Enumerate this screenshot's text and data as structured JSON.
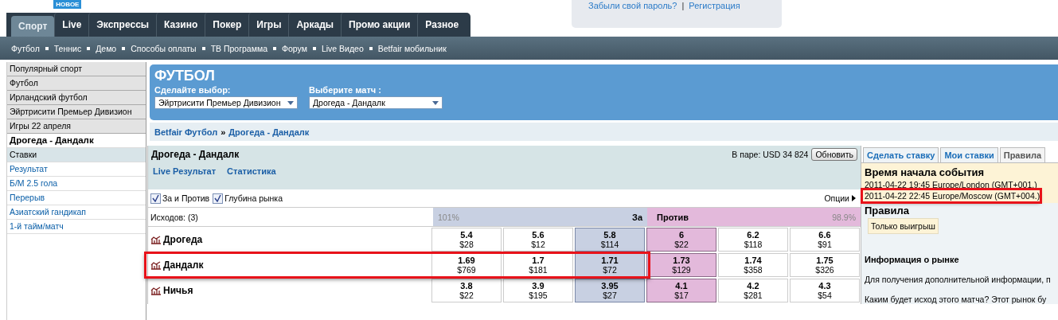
{
  "nav": {
    "badge": "НОВОЕ",
    "tabs": [
      {
        "label": "Спорт",
        "selected": true
      },
      {
        "label": "Live",
        "selected": false
      },
      {
        "label": "Экспрессы",
        "selected": false
      },
      {
        "label": "Казино",
        "selected": false
      },
      {
        "label": "Покер",
        "selected": false
      },
      {
        "label": "Игры",
        "selected": false
      },
      {
        "label": "Аркады",
        "selected": false
      },
      {
        "label": "Промо акции",
        "selected": false
      },
      {
        "label": "Разное",
        "selected": false
      }
    ]
  },
  "subnav": [
    "Футбол",
    "Теннис",
    "Демо",
    "Способы оплаты",
    "ТВ Программа",
    "Форум",
    "Live Видео",
    "Betfair мобильник"
  ],
  "login": {
    "links": [
      "Забыли свой пароль?",
      "Регистрация"
    ],
    "separator": "|"
  },
  "sidebar": [
    {
      "label": "Популярный спорт",
      "kind": "group"
    },
    {
      "label": "Футбол",
      "kind": "group"
    },
    {
      "label": "Ирландский футбол",
      "kind": "group"
    },
    {
      "label": "Эйртрисити Премьер Дивизион",
      "kind": "group"
    },
    {
      "label": "Игры 22 апреля",
      "kind": "group"
    },
    {
      "label": "Дрогеда - Дандалк",
      "kind": "current"
    },
    {
      "label": "Ставки",
      "kind": "section"
    },
    {
      "label": "Результат",
      "kind": "link"
    },
    {
      "label": "Б/М 2.5 гола",
      "kind": "link"
    },
    {
      "label": "Перерыв",
      "kind": "link"
    },
    {
      "label": "Азиатский гандикап",
      "kind": "link"
    },
    {
      "label": "1-й тайм/матч",
      "kind": "link"
    }
  ],
  "header": {
    "title": "ФУТБОЛ",
    "selects": [
      {
        "label": "Сделайте выбор:",
        "value": "Эйртрисити Премьер Дивизион"
      },
      {
        "label": "Выберите матч :",
        "value": "Дрогеда - Дандалк"
      }
    ]
  },
  "breadcrumb": {
    "items": [
      "Betfair Футбол",
      "Дрогеда - Дандалк"
    ],
    "separator": "»"
  },
  "market": {
    "title": "Дрогеда - Дандалк",
    "matched": "В паре: USD 34 824",
    "refresh": "Обновить",
    "links": [
      "Live Результат",
      "Статистика"
    ],
    "options": [
      {
        "label": "За и Против",
        "checked": true
      },
      {
        "label": "Глубина рынка",
        "checked": true
      }
    ],
    "options_menu": "Опции",
    "runners_count": "Исходов:  (3)",
    "back_header": {
      "percent": "101%",
      "label": "За"
    },
    "lay_header": {
      "label": "Против",
      "percent": "98.9%"
    },
    "runners": [
      {
        "name": "Дрогеда",
        "highlighted": false,
        "prices": [
          {
            "odds": "5.4",
            "amount": "$28"
          },
          {
            "odds": "5.6",
            "amount": "$12"
          },
          {
            "odds": "5.8",
            "amount": "$114"
          },
          {
            "odds": "6",
            "amount": "$22"
          },
          {
            "odds": "6.2",
            "amount": "$118"
          },
          {
            "odds": "6.6",
            "amount": "$91"
          }
        ]
      },
      {
        "name": "Дандалк",
        "highlighted": true,
        "prices": [
          {
            "odds": "1.69",
            "amount": "$769"
          },
          {
            "odds": "1.7",
            "amount": "$181"
          },
          {
            "odds": "1.71",
            "amount": "$72"
          },
          {
            "odds": "1.73",
            "amount": "$129"
          },
          {
            "odds": "1.74",
            "amount": "$358"
          },
          {
            "odds": "1.75",
            "amount": "$326"
          }
        ]
      },
      {
        "name": "Ничья",
        "highlighted": false,
        "prices": [
          {
            "odds": "3.8",
            "amount": "$22"
          },
          {
            "odds": "3.9",
            "amount": "$195"
          },
          {
            "odds": "3.95",
            "amount": "$27"
          },
          {
            "odds": "4.1",
            "amount": "$17"
          },
          {
            "odds": "4.2",
            "amount": "$281"
          },
          {
            "odds": "4.3",
            "amount": "$54"
          }
        ]
      }
    ]
  },
  "rules_panel": {
    "tabs": [
      {
        "label": "Сделать ставку",
        "selected": false
      },
      {
        "label": "Мои ставки",
        "selected": false
      },
      {
        "label": "Правила",
        "selected": true
      }
    ],
    "start_time": {
      "title": "Время начала события",
      "lines": [
        {
          "text": "2011-04-22 19:45 Europe/London (GMT+001.)",
          "highlighted": false
        },
        {
          "text": "2011-04-22 22:45 Europe/Moscow (GMT+004.)",
          "highlighted": true
        }
      ]
    },
    "rules_title": "Правила",
    "rule_badge": "Только выигрыш",
    "info_title": "Информация о рынке",
    "paragraphs": [
      "Для получения дополнительной информации, п",
      "Каким будет исход этого матча? Этот рынок бу"
    ]
  }
}
